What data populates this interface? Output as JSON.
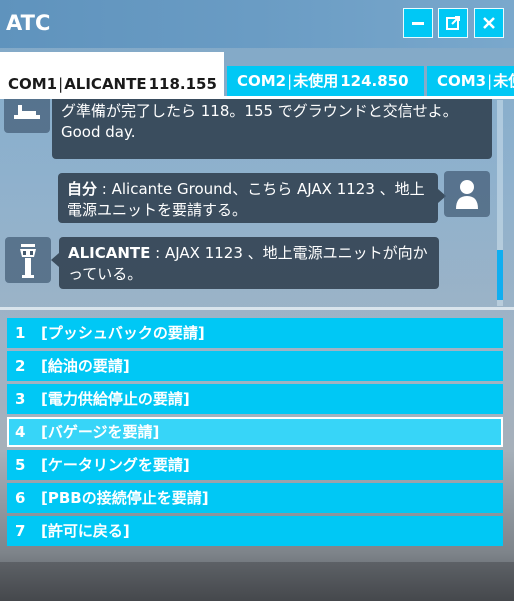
{
  "window": {
    "title": "ATC",
    "minimize_label": "—",
    "close_label": "✕",
    "popout_icon": "popout-icon"
  },
  "tabs": [
    {
      "channel": "COM1",
      "station": "ALICANTE",
      "frequency": "118.155",
      "active": true
    },
    {
      "channel": "COM2",
      "station": "未使用",
      "frequency": "124.850",
      "active": false
    },
    {
      "channel": "COM3",
      "station": "未使用",
      "frequency": "",
      "active": false
    }
  ],
  "chat": {
    "messages": [
      {
        "from": "atc",
        "icon": "runway-icon",
        "text": "グ準備が完了したら 118。155 でグラウンドと交信せよ。Good day."
      },
      {
        "from": "self",
        "icon": "pilot-icon",
        "speaker": "自分",
        "text": " : Alicante Ground、こちら AJAX 1123 、地上電源ユニットを要請する。"
      },
      {
        "from": "atc",
        "icon": "tower-icon",
        "speaker": "ALICANTE",
        "text": " : AJAX 1123 、地上電源ユニットが向かっている。"
      }
    ]
  },
  "menu": {
    "selected_index": 3,
    "items": [
      {
        "num": "1",
        "label": "[プッシュバックの要請]"
      },
      {
        "num": "2",
        "label": "[給油の要請]"
      },
      {
        "num": "3",
        "label": "[電力供給停止の要請]"
      },
      {
        "num": "4",
        "label": "[バゲージを要請]"
      },
      {
        "num": "5",
        "label": "[ケータリングを要請]"
      },
      {
        "num": "6",
        "label": "[PBBの接続停止を要請]"
      },
      {
        "num": "7",
        "label": "[許可に戻る]"
      }
    ]
  },
  "colors": {
    "accent": "#00c8f5",
    "bubble": "#28374699",
    "selected_item": "#37d5f8"
  }
}
